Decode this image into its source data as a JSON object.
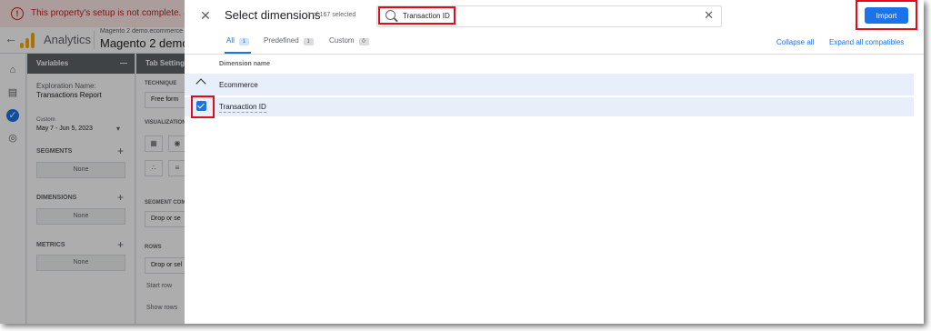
{
  "background": {
    "warning_text": "This property's setup is not complete. Settings ma",
    "app_name": "Analytics",
    "property_small": "Magento 2 demo.ecommerce",
    "property_name": "Magento 2 demo.s",
    "variables_panel": {
      "title": "Variables",
      "exploration_label": "Exploration Name:",
      "exploration_name": "Transactions Report",
      "date_label": "Custom",
      "date_range": "May 7 - Jun 5, 2023",
      "segments_label": "SEGMENTS",
      "segments_value": "None",
      "dimensions_label": "DIMENSIONS",
      "dimensions_value": "None",
      "metrics_label": "METRICS",
      "metrics_value": "None"
    },
    "tab_settings": {
      "title": "Tab Settings",
      "technique_label": "TECHNIQUE",
      "technique_value": "Free form",
      "visualization_label": "VISUALIZATION",
      "segment_label": "SEGMENT COMP",
      "segment_drop": "Drop or se",
      "rows_label": "ROWS",
      "rows_drop": "Drop or sel",
      "start_row": "Start row",
      "show_rows": "Show rows"
    }
  },
  "dialog": {
    "title": "Select dimensions",
    "selected_count": "1 of 167 selected",
    "search": {
      "value": "Transaction ID",
      "placeholder": "Search"
    },
    "import_label": "Import",
    "tabs": [
      {
        "label": "All",
        "count": "1"
      },
      {
        "label": "Predefined",
        "count": "1"
      },
      {
        "label": "Custom",
        "count": "0"
      }
    ],
    "collapse_all": "Collapse all",
    "expand_all": "Expand all compatibles",
    "column_header": "Dimension name",
    "group": "Ecommerce",
    "dimension": "Transaction ID"
  },
  "colors": {
    "accent": "#1a73e8",
    "highlight": "#e30b17",
    "selected_row": "#e8eefa"
  }
}
